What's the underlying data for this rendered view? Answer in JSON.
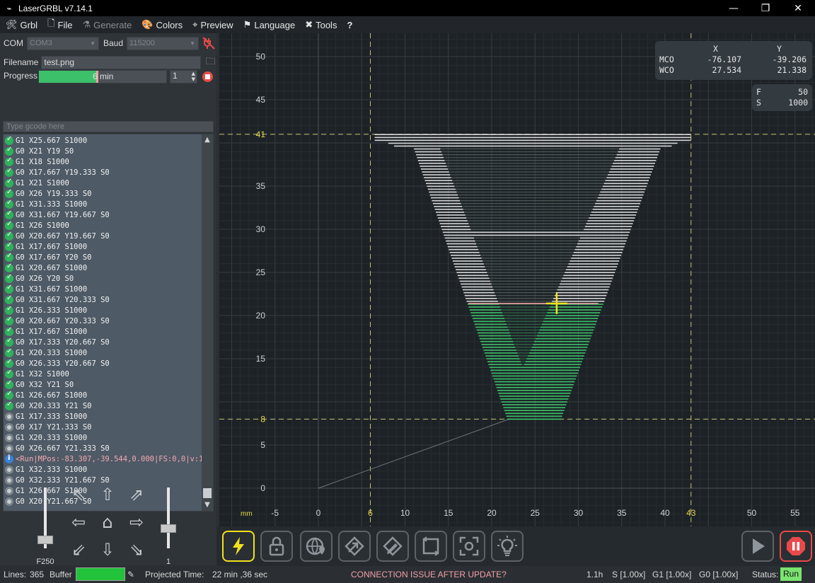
{
  "window": {
    "title": "LaserGRBL v7.14.1",
    "app_icon": "laser-icon"
  },
  "menu": [
    {
      "label": "Grbl",
      "icon": "wrench-icon",
      "disabled": false
    },
    {
      "label": "File",
      "icon": "file-icon",
      "disabled": false
    },
    {
      "label": "Generate",
      "icon": "flask-icon",
      "disabled": true
    },
    {
      "label": "Colors",
      "icon": "palette-icon",
      "disabled": false
    },
    {
      "label": "Preview",
      "icon": "target-icon",
      "disabled": false
    },
    {
      "label": "Language",
      "icon": "flag-icon",
      "disabled": false
    },
    {
      "label": "Tools",
      "icon": "tools-icon",
      "disabled": false
    },
    {
      "label": "?",
      "icon": "help-icon",
      "disabled": false
    }
  ],
  "connection": {
    "com_label": "COM",
    "com_value": "COM3",
    "baud_label": "Baud",
    "baud_value": "115200"
  },
  "file": {
    "label": "Filename",
    "value": "test.png"
  },
  "progress": {
    "label": "Progress",
    "fraction": 0.45,
    "text": "6 min",
    "repeat_count": "1"
  },
  "command_input": {
    "placeholder": "Type gcode here"
  },
  "gcode_lines": [
    {
      "s": "ok",
      "t": "G1 X25.667 S1000"
    },
    {
      "s": "ok",
      "t": "G0 X21 Y19 S0"
    },
    {
      "s": "ok",
      "t": "G1 X18 S1000"
    },
    {
      "s": "ok",
      "t": "G0 X17.667 Y19.333 S0"
    },
    {
      "s": "ok",
      "t": "G1 X21 S1000"
    },
    {
      "s": "ok",
      "t": "G0 X26 Y19.333 S0"
    },
    {
      "s": "ok",
      "t": "G1 X31.333 S1000"
    },
    {
      "s": "ok",
      "t": "G0 X31.667 Y19.667 S0"
    },
    {
      "s": "ok",
      "t": "G1 X26 S1000"
    },
    {
      "s": "ok",
      "t": "G0 X20.667 Y19.667 S0"
    },
    {
      "s": "ok",
      "t": "G1 X17.667 S1000"
    },
    {
      "s": "ok",
      "t": "G0 X17.667 Y20 S0"
    },
    {
      "s": "ok",
      "t": "G1 X20.667 S1000"
    },
    {
      "s": "ok",
      "t": "G0 X26 Y20 S0"
    },
    {
      "s": "ok",
      "t": "G1 X31.667 S1000"
    },
    {
      "s": "ok",
      "t": "G0 X31.667 Y20.333 S0"
    },
    {
      "s": "ok",
      "t": "G1 X26.333 S1000"
    },
    {
      "s": "ok",
      "t": "G0 X20.667 Y20.333 S0"
    },
    {
      "s": "ok",
      "t": "G1 X17.667 S1000"
    },
    {
      "s": "ok",
      "t": "G0 X17.333 Y20.667 S0"
    },
    {
      "s": "ok",
      "t": "G1 X20.333 S1000"
    },
    {
      "s": "ok",
      "t": "G0 X26.333 Y20.667 S0"
    },
    {
      "s": "ok",
      "t": "G1 X32 S1000"
    },
    {
      "s": "ok",
      "t": "G0 X32 Y21 S0"
    },
    {
      "s": "ok",
      "t": "G1 X26.667 S1000"
    },
    {
      "s": "ok",
      "t": "G0 X20.333 Y21 S0"
    },
    {
      "s": "pending",
      "t": "G1 X17.333 S1000"
    },
    {
      "s": "pending",
      "t": "G0 X17 Y21.333 S0"
    },
    {
      "s": "pending",
      "t": "G1 X20.333 S1000"
    },
    {
      "s": "pending",
      "t": "G0 X26.667 Y21.333 S0"
    },
    {
      "s": "info",
      "t": "<Run|MPos:-83.307,-39.544,0.000|FS:0,0|v:1..."
    },
    {
      "s": "pending",
      "t": "G1 X32.333 S1000"
    },
    {
      "s": "pending",
      "t": "G0 X32.333 Y21.667 S0"
    },
    {
      "s": "pending",
      "t": "G1 X26.667 S1000"
    },
    {
      "s": "pending",
      "t": "G0 X20 Y21.667 S0"
    }
  ],
  "jog": {
    "speed_label": "F250",
    "step_label": "1"
  },
  "coords": {
    "x_header": "X",
    "y_header": "Y",
    "mco_label": "MCO",
    "mco_x": "-76.107",
    "mco_y": "-39.206",
    "wco_label": "WCO",
    "wco_x": "27.534",
    "wco_y": "21.338",
    "f_label": "F",
    "f_value": "50",
    "s_label": "S",
    "s_value": "1000"
  },
  "axes": {
    "unit_label": "mm",
    "x_ticks": [
      "-5",
      "0",
      "10",
      "15",
      "20",
      "25",
      "30",
      "35",
      "40",
      "50",
      "55"
    ],
    "x_tick_values": [
      -5,
      0,
      10,
      15,
      20,
      25,
      30,
      35,
      40,
      50,
      55
    ],
    "x_bounds": [
      "6",
      "43"
    ],
    "x_bound_values": [
      6,
      43
    ],
    "y_ticks": [
      "50",
      "45",
      "35",
      "30",
      "25",
      "20",
      "15",
      "5",
      "0"
    ],
    "y_tick_values": [
      50,
      45,
      35,
      30,
      25,
      20,
      15,
      5,
      0
    ],
    "y_bounds": [
      "41",
      "8"
    ],
    "y_bound_values": [
      41,
      8
    ],
    "cursor": {
      "x": 27.5,
      "y": 21.4
    }
  },
  "status": {
    "lines_label": "Lines:",
    "lines_value": "365",
    "buffer_label": "Buffer",
    "projected_label": "Projected Time:",
    "projected_value": "22 min ,36 sec",
    "notice": "CONNECTION ISSUE AFTER UPDATE?",
    "elapsed": "1.1h",
    "s_override": "S [1.00x]",
    "g1_override": "G1 [1.00x]",
    "g0_override": "G0 [1.00x]",
    "status_label": "Status:",
    "status_value": "Run"
  },
  "colors": {
    "accent": "#f2e21e",
    "engraved": "#3dc06a",
    "pending": "#d6d6d6",
    "stop": "#e84a4a"
  }
}
